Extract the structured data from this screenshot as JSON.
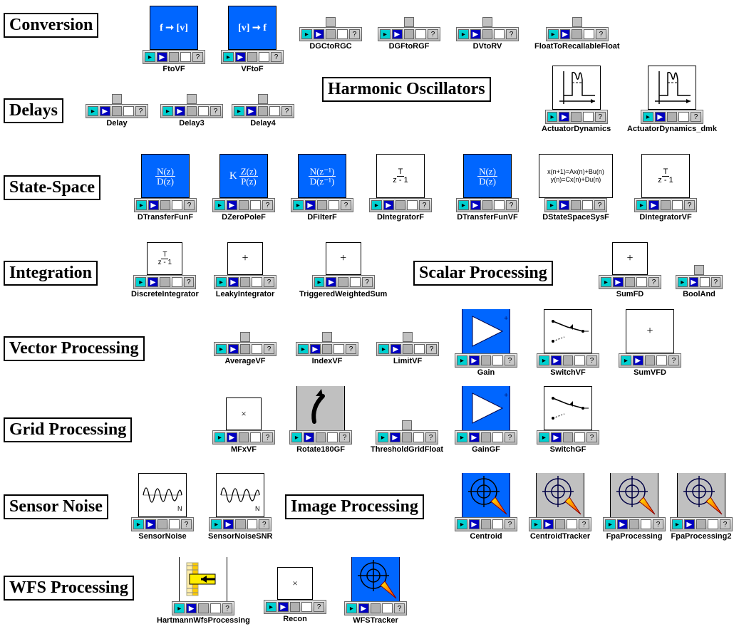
{
  "colors": {
    "accent_blue": "#0066ff",
    "panel_gray": "#c0c0c0",
    "cyan": "#00d0d0",
    "navy": "#0000c0"
  },
  "toolbar": {
    "question": "?"
  },
  "headings": {
    "conversion": "Conversion",
    "delays": "Delays",
    "harmonic": "Harmonic Oscillators",
    "statespace": "State-Space",
    "integration": "Integration",
    "scalar": "Scalar Processing",
    "vector": "Vector Processing",
    "grid": "Grid Processing",
    "sensor": "Sensor Noise",
    "image": "Image Processing",
    "wfs": "WFS Processing"
  },
  "blocks": {
    "ftovf": {
      "label": "FtoVF",
      "tile": "f ➞ [v]"
    },
    "vftof": {
      "label": "VFtoF",
      "tile": "[v] ➞ f"
    },
    "dgctorgc": {
      "label": "DGCtoRGC"
    },
    "dgftorgf": {
      "label": "DGFtoRGF"
    },
    "dvtorv": {
      "label": "DVtoRV"
    },
    "floattorec": {
      "label": "FloatToRecallableFloat"
    },
    "delay": {
      "label": "Delay"
    },
    "delay3": {
      "label": "Delay3"
    },
    "delay4": {
      "label": "Delay4"
    },
    "actdyn": {
      "label": "ActuatorDynamics"
    },
    "actdyndmk": {
      "label": "ActuatorDynamics_dmk"
    },
    "dtransferfunf": {
      "label": "DTransferFunF",
      "num": "N(z)",
      "den": "D(z)"
    },
    "dzeropolef": {
      "label": "DZeroPoleF",
      "pre": "K",
      "num": "Z(z)",
      "den": "P(z)"
    },
    "dfilterf": {
      "label": "DFilterF",
      "num": "N(z⁻¹)",
      "den": "D(z⁻¹)"
    },
    "dintegratorf": {
      "label": "DIntegratorF",
      "num": "T",
      "den": "z - 1"
    },
    "dtransferfunvf": {
      "label": "DTransferFunVF",
      "num": "N(z)",
      "den": "D(z)"
    },
    "dstatespace": {
      "label": "DStateSpaceSysF",
      "l1": "x(n+1)=Ax(n)+Bu(n)",
      "l2": "y(n)=Cx(n)+Du(n)"
    },
    "dintegratorvf": {
      "label": "DIntegratorVF",
      "num": "T",
      "den": "z - 1"
    },
    "discreteint": {
      "label": "DiscreteIntegrator",
      "num": "T",
      "den": "z - 1"
    },
    "leakyint": {
      "label": "LeakyIntegrator",
      "sym": "+"
    },
    "trigwsum": {
      "label": "TriggeredWeightedSum",
      "sym": "+"
    },
    "sumfd": {
      "label": "SumFD",
      "sym": "+"
    },
    "booland": {
      "label": "BoolAnd"
    },
    "averagevf": {
      "label": "AverageVF"
    },
    "indexvf": {
      "label": "IndexVF"
    },
    "limitvf": {
      "label": "LimitVF"
    },
    "gain": {
      "label": "Gain"
    },
    "switchvf": {
      "label": "SwitchVF"
    },
    "sumvfd": {
      "label": "SumVFD",
      "sym": "+"
    },
    "mfxvf": {
      "label": "MFxVF",
      "sym": "×"
    },
    "rotate180gf": {
      "label": "Rotate180GF"
    },
    "threshgf": {
      "label": "ThresholdGridFloat"
    },
    "gaingf": {
      "label": "GainGF"
    },
    "switchgf": {
      "label": "SwitchGF"
    },
    "sensornoise": {
      "label": "SensorNoise"
    },
    "sensornoisesnr": {
      "label": "SensorNoiseSNR"
    },
    "centroid": {
      "label": "Centroid"
    },
    "centroidtrack": {
      "label": "CentroidTracker"
    },
    "fpaproc": {
      "label": "FpaProcessing"
    },
    "fpaproc2": {
      "label": "FpaProcessing2"
    },
    "hartmann": {
      "label": "HartmannWfsProcessing"
    },
    "recon": {
      "label": "Recon",
      "sym": "×"
    },
    "wfstracker": {
      "label": "WFSTracker"
    }
  }
}
